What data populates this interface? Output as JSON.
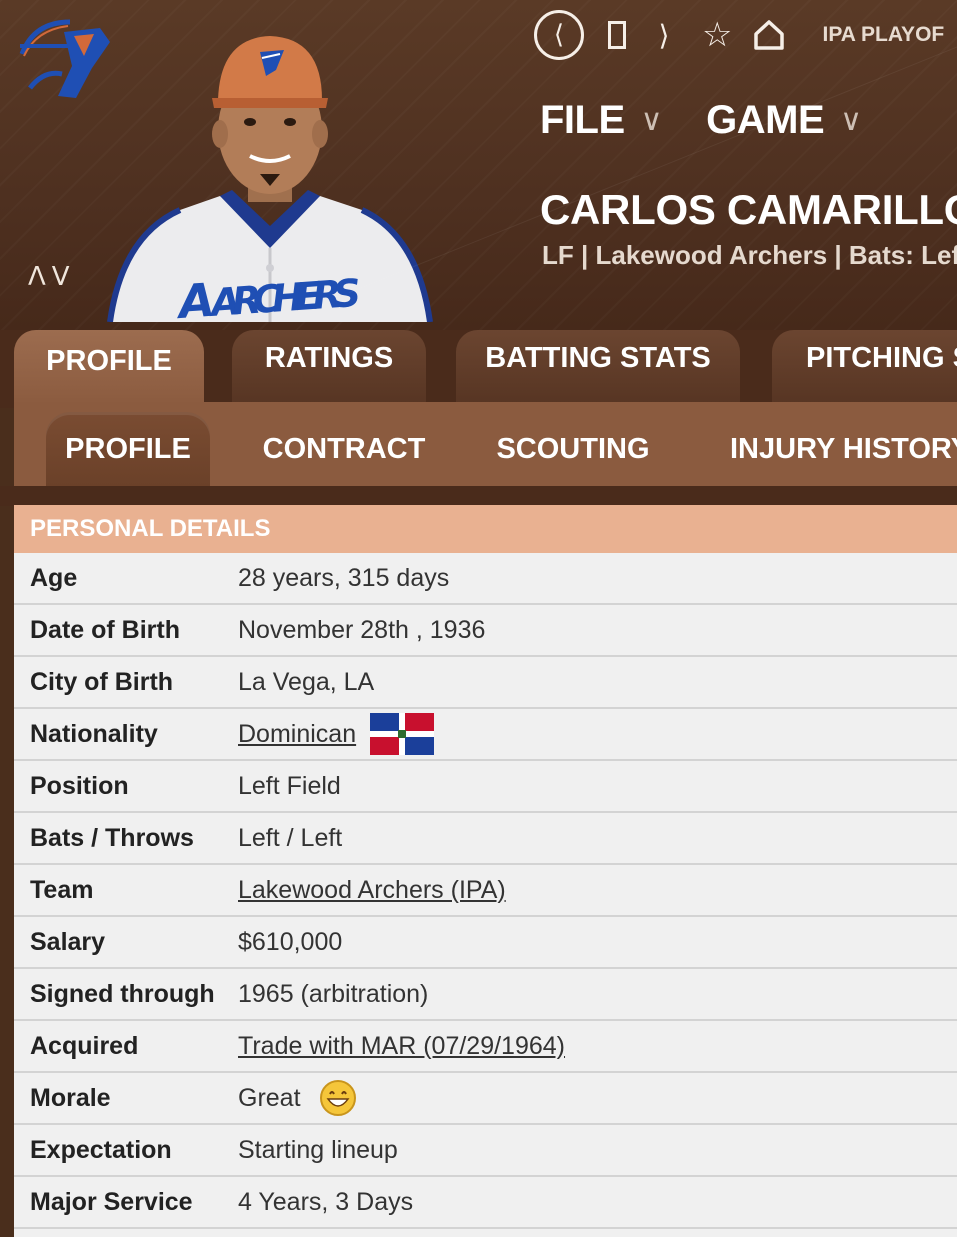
{
  "topnav": {
    "league_text": "IPA PLAYOF"
  },
  "menu": [
    {
      "label": "FILE"
    },
    {
      "label": "GAME"
    }
  ],
  "player": {
    "name": "CARLOS CAMARILLO  |",
    "subtitle": "LF | Lakewood Archers  |  Bats: Lef",
    "jersey_text": "ARCHERS"
  },
  "tabs_primary": [
    {
      "label": "PROFILE",
      "active": true
    },
    {
      "label": "RATINGS",
      "active": false
    },
    {
      "label": "BATTING STATS",
      "active": false
    },
    {
      "label": "PITCHING S",
      "active": false
    }
  ],
  "tabs_secondary": [
    {
      "label": "PROFILE",
      "active": true
    },
    {
      "label": "CONTRACT",
      "active": false
    },
    {
      "label": "SCOUTING",
      "active": false
    },
    {
      "label": "INJURY HISTORY",
      "active": false
    }
  ],
  "personal_details": {
    "title": "PERSONAL DETAILS",
    "rows": [
      {
        "label": "Age",
        "value": "28 years, 315 days"
      },
      {
        "label": "Date of Birth",
        "value": "November 28th , 1936"
      },
      {
        "label": "City of Birth",
        "value": "La Vega, LA"
      },
      {
        "label": "Nationality",
        "value": "Dominican",
        "icon": "dominican-flag-icon"
      },
      {
        "label": "Position",
        "value": "Left Field"
      },
      {
        "label": "Bats / Throws",
        "value": "Left / Left"
      },
      {
        "label": "Team",
        "value": "Lakewood Archers (IPA)"
      },
      {
        "label": "Salary",
        "value": "$610,000"
      },
      {
        "label": "Signed through",
        "value": "1965 (arbitration)"
      },
      {
        "label": "Acquired",
        "value": "Trade with MAR (07/29/1964)"
      },
      {
        "label": "Morale",
        "value": "Great",
        "icon": "smiley-icon"
      },
      {
        "label": "Expectation",
        "value": "Starting lineup"
      },
      {
        "label": "Major Service",
        "value": "4 Years, 3 Days"
      }
    ]
  },
  "colors": {
    "header_bg": "#4e3020",
    "tab_active": "#8a5a3e",
    "section_header": "#e9b191",
    "row_bg": "#f0f0f0",
    "team_blue": "#1f4fb4",
    "team_orange": "#d2693a"
  },
  "icons": [
    "team-logo-icon",
    "back-icon",
    "stop-icon",
    "forward-icon",
    "star-icon",
    "home-icon",
    "chevron-down-icon",
    "up-arrow-icon",
    "down-arrow-icon"
  ]
}
